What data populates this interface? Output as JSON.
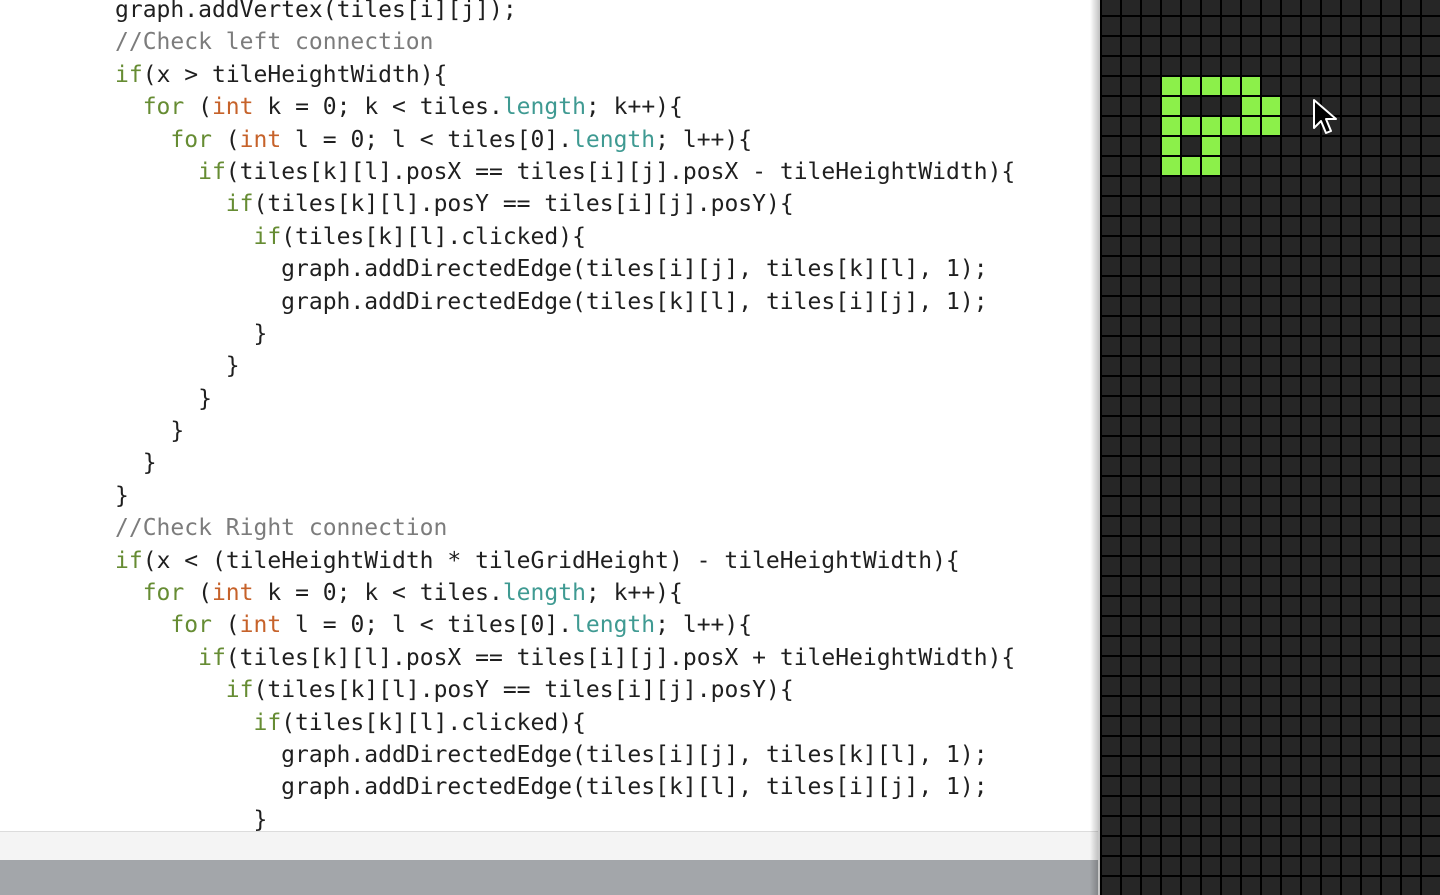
{
  "editor": {
    "lines": [
      "graph.addVertex(tiles[i][j]);",
      "//Check left connection",
      "if(x > tileHeightWidth){",
      "  for (int k = 0; k < tiles.length; k++){",
      "    for (int l = 0; l < tiles[0].length; l++){",
      "      if(tiles[k][l].posX == tiles[i][j].posX - tileHeightWidth){",
      "        if(tiles[k][l].posY == tiles[i][j].posY){",
      "          if(tiles[k][l].clicked){",
      "            graph.addDirectedEdge(tiles[i][j], tiles[k][l], 1);",
      "            graph.addDirectedEdge(tiles[k][l], tiles[i][j], 1);",
      "          }",
      "        }",
      "      }",
      "    }",
      "  }",
      "}",
      "//Check Right connection",
      "if(x < (tileHeightWidth * tileGridHeight) - tileHeightWidth){",
      "  for (int k = 0; k < tiles.length; k++){",
      "    for (int l = 0; l < tiles[0].length; l++){",
      "      if(tiles[k][l].posX == tiles[i][j].posX + tileHeightWidth){",
      "        if(tiles[k][l].posY == tiles[i][j].posY){",
      "          if(tiles[k][l].clicked){",
      "            graph.addDirectedEdge(tiles[i][j], tiles[k][l], 1);",
      "            graph.addDirectedEdge(tiles[k][l], tiles[i][j], 1);",
      "          }"
    ],
    "keywords": [
      "if",
      "for"
    ],
    "types": [
      "int"
    ],
    "builtins": [
      "length"
    ],
    "comment_prefix": "//"
  },
  "sketch": {
    "grid_columns": 17,
    "grid_rows": 45,
    "clicked_tiles": [
      [
        3,
        3
      ],
      [
        4,
        3
      ],
      [
        5,
        3
      ],
      [
        6,
        3
      ],
      [
        7,
        3
      ],
      [
        3,
        4
      ],
      [
        7,
        4
      ],
      [
        8,
        4
      ],
      [
        3,
        5
      ],
      [
        4,
        5
      ],
      [
        5,
        5
      ],
      [
        6,
        5
      ],
      [
        7,
        5
      ],
      [
        8,
        5
      ],
      [
        3,
        6
      ],
      [
        5,
        6
      ],
      [
        3,
        7
      ],
      [
        4,
        7
      ],
      [
        5,
        7
      ]
    ]
  },
  "colors": {
    "keyword": "#668c33",
    "type": "#c6622a",
    "builtin": "#3f9a92",
    "comment": "#7c7c7c",
    "text": "#1f1f1f",
    "tile_empty": "#262626",
    "tile_clicked": "#8cf04a",
    "grid_line": "#000000",
    "bottom_bar": "#a3a6aa"
  },
  "icons": {
    "cursor": "arrow-pointer-icon"
  }
}
